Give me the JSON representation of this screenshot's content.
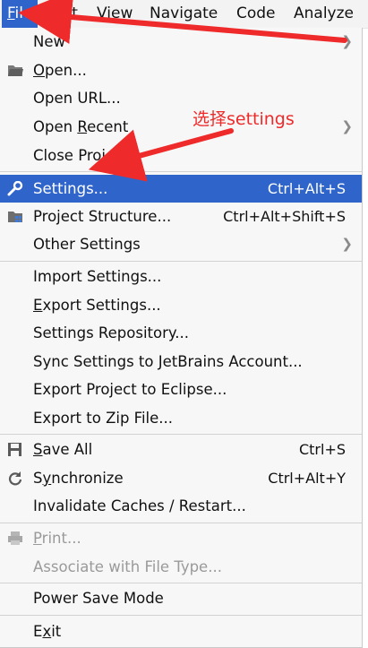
{
  "menubar": {
    "items": [
      {
        "label": "File",
        "underline": "F",
        "rest": "ile"
      },
      {
        "label": "Edit"
      },
      {
        "label": "View"
      },
      {
        "label": "Navigate"
      },
      {
        "label": "Code"
      },
      {
        "label": "Analyze"
      }
    ]
  },
  "menu": {
    "new": "New",
    "open_u": "O",
    "open_rest": "pen...",
    "open_url": "Open URL...",
    "open_recent_a": "Open ",
    "open_recent_u": "R",
    "open_recent_b": "ecent",
    "close_project": "Close Project",
    "settings": "Settings...",
    "settings_sc": "Ctrl+Alt+S",
    "project_structure": "Project Structure...",
    "project_structure_sc": "Ctrl+Alt+Shift+S",
    "other_settings": "Other Settings",
    "import_settings": "Import Settings...",
    "export_u": "E",
    "export_rest": "xport Settings...",
    "settings_repository": "Settings Repository...",
    "sync_settings": "Sync Settings to JetBrains Account...",
    "export_eclipse": "Export Project to Eclipse...",
    "export_zip": "Export to Zip File...",
    "save_all_u": "S",
    "save_all_rest": "ave All",
    "save_all_sc": "Ctrl+S",
    "sync_a": "S",
    "sync_u": "y",
    "sync_b": "nchronize",
    "sync_sc": "Ctrl+Alt+Y",
    "invalidate": "Invalidate Caches / Restart...",
    "print_u": "P",
    "print_rest": "rint...",
    "associate": "Associate with File Type...",
    "power_save": "Power Save Mode",
    "exit_a": "E",
    "exit_u": "x",
    "exit_b": "it"
  },
  "annotation": {
    "text": "选择settings",
    "color": "#ee2a2a"
  },
  "colors": {
    "selection": "#2f65ca",
    "menu_bg": "#f7f7f7"
  }
}
